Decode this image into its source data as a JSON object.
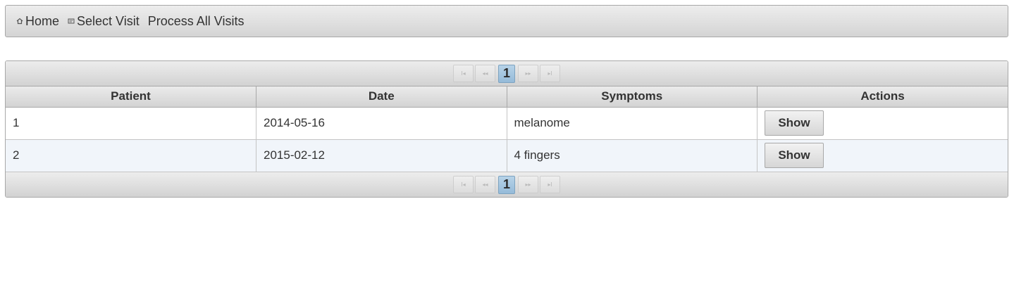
{
  "menu": {
    "items": [
      {
        "label": "Home",
        "icon": "home-icon"
      },
      {
        "label": "Select Visit",
        "icon": "card-icon"
      },
      {
        "label": "Process All Visits",
        "icon": ""
      }
    ]
  },
  "paginator": {
    "first": "I◂",
    "prev": "◂◂",
    "current_page": "1",
    "next": "▸▸",
    "last": "▸I"
  },
  "table": {
    "columns": [
      "Patient",
      "Date",
      "Symptoms",
      "Actions"
    ],
    "rows": [
      {
        "patient": "1",
        "date": "2014-05-16",
        "symptoms": "melanome",
        "action": "Show"
      },
      {
        "patient": "2",
        "date": "2015-02-12",
        "symptoms": "4 fingers",
        "action": "Show"
      }
    ]
  },
  "colors": {
    "selected_page": "#95bbd9",
    "even_row": "#f1f5fa"
  }
}
